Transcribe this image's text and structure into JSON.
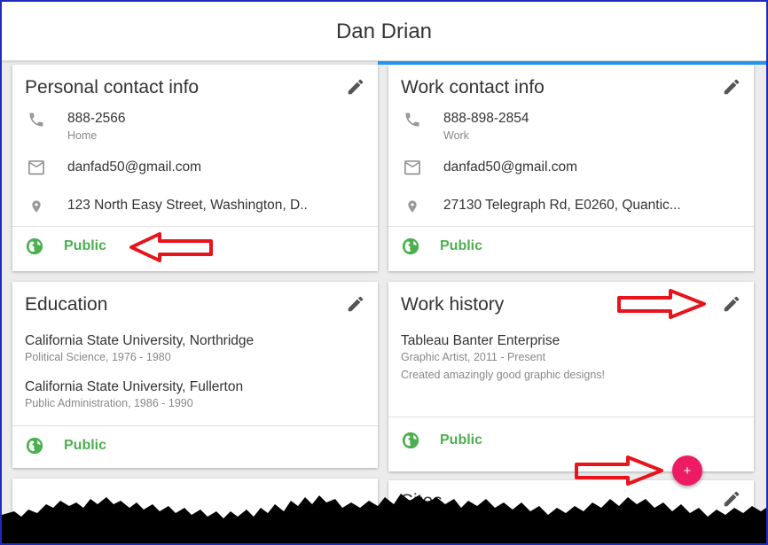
{
  "profile": {
    "name": "Dan Drian"
  },
  "personal_contact": {
    "title": "Personal contact info",
    "phone": "888-2566",
    "phone_type": "Home",
    "email": "danfad50@gmail.com",
    "address": "123 North Easy Street, Washington, D..",
    "visibility": "Public"
  },
  "work_contact": {
    "title": "Work contact info",
    "phone": "888-898-2854",
    "phone_type": "Work",
    "email": "danfad50@gmail.com",
    "address": "27130 Telegraph Rd, E0260, Quantic...",
    "visibility": "Public"
  },
  "education": {
    "title": "Education",
    "entries": [
      {
        "school": "California State University, Northridge",
        "detail": "Political Science, 1976 - 1980"
      },
      {
        "school": "California State University, Fullerton",
        "detail": "Public Administration, 1986 - 1990"
      }
    ],
    "visibility": "Public"
  },
  "work_history": {
    "title": "Work history",
    "company": "Tableau Banter Enterprise",
    "role": "Graphic Artist, 2011 - Present",
    "description": "Created amazingly good graphic designs!",
    "visibility": "Public"
  },
  "sites": {
    "title": "Sites"
  },
  "fab": {
    "label": "+"
  },
  "colors": {
    "accent_green": "#4caf50",
    "fab_pink": "#ec1b63",
    "annotation_red": "#e8141c",
    "frame_blue": "#1f2bbf"
  },
  "icons": [
    "phone-icon",
    "email-icon",
    "location-icon",
    "globe-icon",
    "pencil-icon",
    "plus-icon"
  ]
}
